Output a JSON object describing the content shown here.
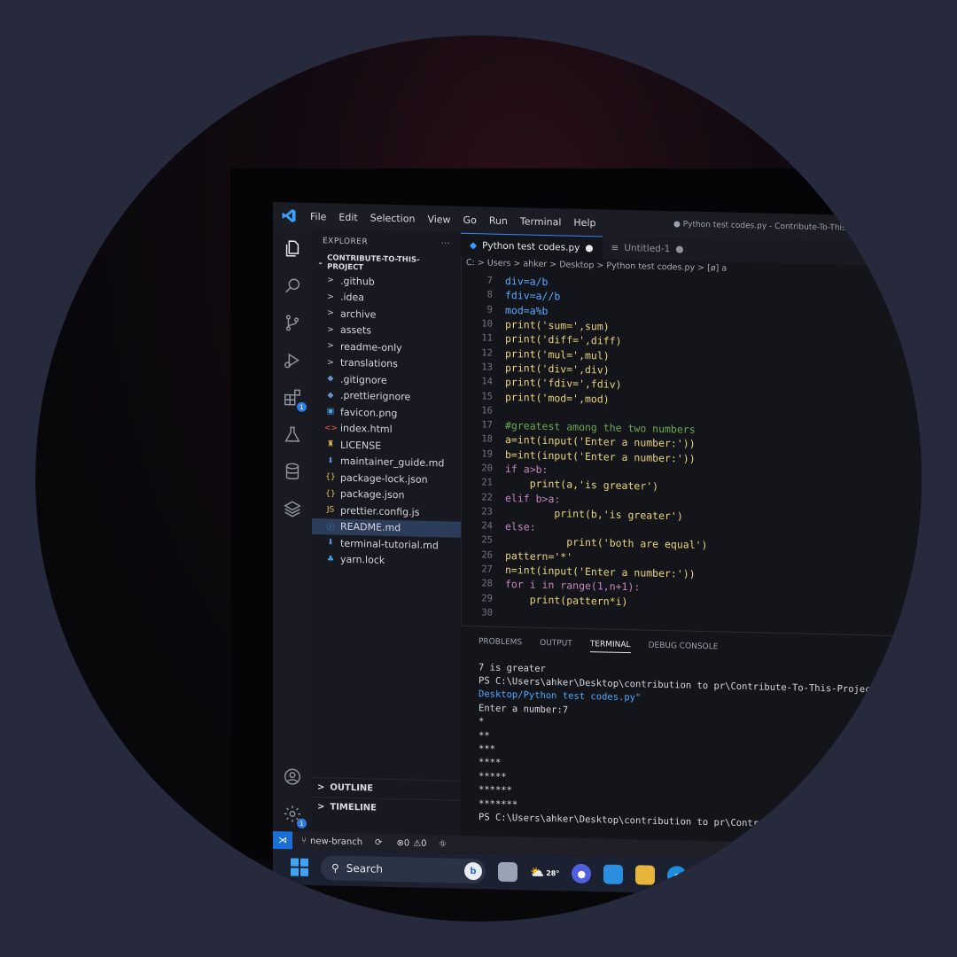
{
  "menu": [
    "File",
    "Edit",
    "Selection",
    "View",
    "Go",
    "Run",
    "Terminal",
    "Help"
  ],
  "window_title": "● Python test codes.py - Contribute-To-This-",
  "explorer": {
    "header": "EXPLORER",
    "more": "···",
    "project": "CONTRIBUTE-TO-THIS-PROJECT",
    "items": [
      {
        "icon": "chevron-right-icon",
        "glyph": ">",
        "label": ".github",
        "color": "#c9ccd3"
      },
      {
        "icon": "chevron-right-icon",
        "glyph": ">",
        "label": ".idea",
        "color": "#c9ccd3"
      },
      {
        "icon": "chevron-right-icon",
        "glyph": ">",
        "label": "archive",
        "color": "#c9ccd3"
      },
      {
        "icon": "chevron-right-icon",
        "glyph": ">",
        "label": "assets",
        "color": "#c9ccd3"
      },
      {
        "icon": "chevron-right-icon",
        "glyph": ">",
        "label": "readme-only",
        "color": "#c9ccd3"
      },
      {
        "icon": "chevron-right-icon",
        "glyph": ">",
        "label": "translations",
        "color": "#c9ccd3"
      },
      {
        "icon": "git-file-icon",
        "glyph": "◆",
        "label": ".gitignore",
        "color": "#6b8fc7"
      },
      {
        "icon": "prettier-file-icon",
        "glyph": "◆",
        "label": ".prettierignore",
        "color": "#6b8fc7"
      },
      {
        "icon": "image-file-icon",
        "glyph": "▣",
        "label": "favicon.png",
        "color": "#4aa0e0"
      },
      {
        "icon": "html-file-icon",
        "glyph": "<>",
        "label": "index.html",
        "color": "#e8623a"
      },
      {
        "icon": "license-file-icon",
        "glyph": "♜",
        "label": "LICENSE",
        "color": "#e3c24a"
      },
      {
        "icon": "markdown-file-icon",
        "glyph": "⬇",
        "label": "maintainer_guide.md",
        "color": "#5c8fd6"
      },
      {
        "icon": "json-file-icon",
        "glyph": "{}",
        "label": "package-lock.json",
        "color": "#e3c24a"
      },
      {
        "icon": "json-file-icon",
        "glyph": "{}",
        "label": "package.json",
        "color": "#e3c24a"
      },
      {
        "icon": "js-file-icon",
        "glyph": "JS",
        "label": "prettier.config.js",
        "color": "#e3c24a"
      },
      {
        "icon": "info-file-icon",
        "glyph": "ⓘ",
        "label": "README.md",
        "color": "#4aa0e0",
        "selected": true
      },
      {
        "icon": "markdown-file-icon",
        "glyph": "⬇",
        "label": "terminal-tutorial.md",
        "color": "#5c8fd6"
      },
      {
        "icon": "yarn-file-icon",
        "glyph": "♣",
        "label": "yarn.lock",
        "color": "#4aa0e0"
      }
    ],
    "outline": "OUTLINE",
    "timeline": "TIMELINE"
  },
  "tabs": [
    {
      "label": "Python test codes.py",
      "dot": "●",
      "active": true
    },
    {
      "label": "Untitled-1",
      "dot": "●",
      "active": false
    }
  ],
  "breadcrumb": "C: > Users > ahker > Desktop > Python test codes.py > [ø] a",
  "code": [
    {
      "n": "7",
      "text": "div=a/b",
      "color": "#5aa8ff"
    },
    {
      "n": "8",
      "text": "fdiv=a//b",
      "color": "#5aa8ff"
    },
    {
      "n": "9",
      "text": "mod=a%b",
      "color": "#5aa8ff"
    },
    {
      "n": "10",
      "text": "print('sum=',sum)",
      "color": "#e8d37a"
    },
    {
      "n": "11",
      "text": "print('diff=',diff)",
      "color": "#e8d37a"
    },
    {
      "n": "12",
      "text": "print('mul=',mul)",
      "color": "#e8d37a"
    },
    {
      "n": "13",
      "text": "print('div=',div)",
      "color": "#e8d37a"
    },
    {
      "n": "14",
      "text": "print('fdiv=',fdiv)",
      "color": "#e8d37a"
    },
    {
      "n": "15",
      "text": "print('mod=',mod)",
      "color": "#e8d37a"
    },
    {
      "n": "16",
      "text": "",
      "color": "#e8d37a"
    },
    {
      "n": "17",
      "text": "#greatest among the two numbers",
      "color": "#6aa84f"
    },
    {
      "n": "18",
      "text": "a=int(input('Enter a number:'))",
      "color": "#e8d37a"
    },
    {
      "n": "19",
      "text": "b=int(input('Enter a number:'))",
      "color": "#e8d37a"
    },
    {
      "n": "20",
      "text": "if a>b:",
      "color": "#c586c0"
    },
    {
      "n": "21",
      "text": "    print(a,'is greater')",
      "color": "#e8d37a"
    },
    {
      "n": "22",
      "text": "elif b>a:",
      "color": "#c586c0"
    },
    {
      "n": "23",
      "text": "        print(b,'is greater')",
      "color": "#e8d37a"
    },
    {
      "n": "24",
      "text": "else:",
      "color": "#c586c0"
    },
    {
      "n": "25",
      "text": "          print('both are equal')",
      "color": "#e8d37a"
    },
    {
      "n": "26",
      "text": "pattern='*'",
      "color": "#e8d37a"
    },
    {
      "n": "27",
      "text": "n=int(input('Enter a number:'))",
      "color": "#e8d37a"
    },
    {
      "n": "28",
      "text": "for i in range(1,n+1):",
      "color": "#c586c0"
    },
    {
      "n": "29",
      "text": "    print(pattern*i)",
      "color": "#e8d37a"
    },
    {
      "n": "30",
      "text": "",
      "color": "#e8d37a"
    }
  ],
  "panel": {
    "tabs": [
      "PROBLEMS",
      "OUTPUT",
      "TERMINAL",
      "DEBUG CONSOLE"
    ],
    "active": "TERMINAL",
    "lines": [
      {
        "text": "7 is greater",
        "color": "#d5d8df"
      },
      {
        "text": "PS C:\\Users\\ahker\\Desktop\\contribution to pr\\Contribute-To-This-Project> & C:/Users/ahker/",
        "color": "#d5d8df"
      },
      {
        "text": "Desktop/Python test codes.py\"",
        "color": "#4ca8ff"
      },
      {
        "text": "Enter a number:7",
        "color": "#d5d8df"
      },
      {
        "text": "*",
        "color": "#d5d8df"
      },
      {
        "text": "**",
        "color": "#d5d8df"
      },
      {
        "text": "***",
        "color": "#d5d8df"
      },
      {
        "text": "****",
        "color": "#d5d8df"
      },
      {
        "text": "*****",
        "color": "#d5d8df"
      },
      {
        "text": "******",
        "color": "#d5d8df"
      },
      {
        "text": "*******",
        "color": "#d5d8df"
      },
      {
        "text": "PS C:\\Users\\ahker\\Desktop\\contribution to pr\\Contribute-To-This-Project> ▯",
        "color": "#d5d8df"
      }
    ]
  },
  "status": {
    "branch": "new-branch",
    "errors": "0",
    "warnings": "0"
  },
  "taskbar": {
    "search": "Search",
    "weather": "28°"
  },
  "colors": {
    "accent": "#3a86ff",
    "background": "#262a3c"
  }
}
